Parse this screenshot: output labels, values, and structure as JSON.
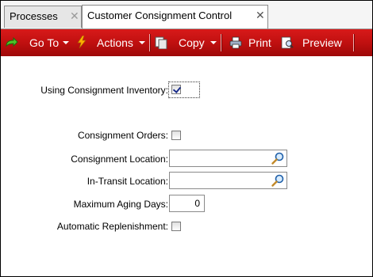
{
  "tabs": [
    {
      "label": "Processes",
      "active": false
    },
    {
      "label": "Customer Consignment Control",
      "active": true
    }
  ],
  "tab_close_glyph": "✕",
  "toolbar": {
    "goto_label": "Go To",
    "actions_label": "Actions",
    "copy_label": "Copy",
    "print_label": "Print",
    "preview_label": "Preview",
    "background_color": "#c01010"
  },
  "form": {
    "using_consignment_label": "Using Consignment Inventory:",
    "using_consignment_checked": true,
    "consignment_orders_label": "Consignment Orders:",
    "consignment_orders_checked": false,
    "consignment_location_label": "Consignment Location:",
    "consignment_location_value": "",
    "in_transit_location_label": "In-Transit Location:",
    "in_transit_location_value": "",
    "max_aging_days_label": "Maximum Aging Days:",
    "max_aging_days_value": "0",
    "auto_replenishment_label": "Automatic Replenishment:",
    "auto_replenishment_checked": false
  },
  "icons": {
    "goto": "green-arrow-icon",
    "actions": "lightning-icon",
    "copy": "copy-icon",
    "print": "printer-icon",
    "preview": "preview-icon",
    "lookup": "search-icon"
  }
}
